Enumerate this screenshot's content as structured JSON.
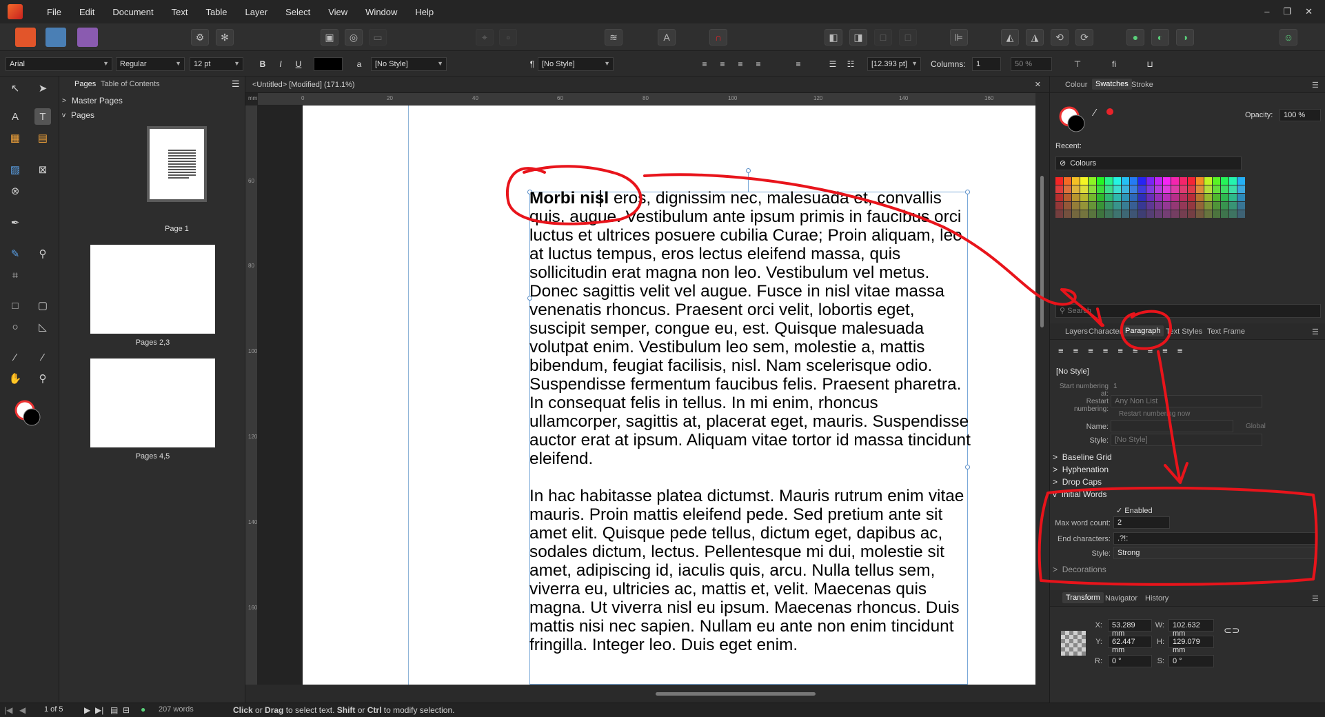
{
  "menu": {
    "items": [
      "File",
      "Edit",
      "Document",
      "Text",
      "Table",
      "Layer",
      "Select",
      "View",
      "Window",
      "Help"
    ],
    "window_controls": [
      "–",
      "❐",
      "✕"
    ]
  },
  "context_toolbar": {
    "font_family": "Arial",
    "font_style": "Regular",
    "font_size": "12 pt",
    "char_style": "[No Style]",
    "para_style": "[No Style]",
    "leading": "[12.393 pt]",
    "columns_label": "Columns:",
    "columns_value": "1",
    "gutter": "50 %",
    "bold": "B",
    "italic": "I",
    "underline": "U",
    "ligature": "fi"
  },
  "pages_panel": {
    "tabs": [
      "Pages",
      "Table of Contents"
    ],
    "master_pages": "Master Pages",
    "pages": "Pages",
    "thumbnails": [
      {
        "label": "Page 1"
      },
      {
        "label": "Pages 2,3"
      },
      {
        "label": "Pages 4,5"
      }
    ]
  },
  "document": {
    "title": "<Untitled> [Modified] (171.1%)",
    "ruler_unit": "mm",
    "ruler_h_ticks": [
      "0",
      "20",
      "40",
      "60",
      "80",
      "100",
      "120",
      "140",
      "160"
    ],
    "ruler_v_ticks": [
      "60",
      "80",
      "100",
      "120",
      "140",
      "160"
    ],
    "initial_words": "Morbi nisl",
    "paragraph1_rest": " eros, dignissim nec, malesuada et, convallis quis, augue. Vestibulum ante ipsum primis in faucibus orci luctus et ultrices posuere cubilia Curae; Proin aliquam, leo at luctus tempus, eros lectus eleifend massa, quis sollicitudin erat magna non leo. Vestibulum vel metus. Donec sagittis velit vel augue. Fusce in nisl vitae massa venenatis rhoncus. Praesent orci velit, lobortis eget, suscipit semper, congue eu, est. Quisque malesuada volutpat enim. Vestibulum leo sem, molestie a, mattis bibendum, feugiat facilisis, nisl. Nam scelerisque odio. Suspendisse fermentum faucibus felis. Praesent pharetra. In consequat felis in tellus. In mi enim, rhoncus ullamcorper, sagittis at, placerat eget, mauris. Suspendisse auctor erat at ipsum. Aliquam vitae tortor id massa tincidunt eleifend.",
    "paragraph2": "In hac habitasse platea dictumst. Mauris rutrum enim vitae mauris. Proin mattis eleifend pede. Sed pretium ante sit amet elit. Quisque pede tellus, dictum eget, dapibus ac, sodales dictum, lectus. Pellentesque mi dui, molestie sit amet, adipiscing id, iaculis quis, arcu. Nulla tellus sem, viverra eu, ultricies ac, mattis et, velit. Maecenas quis magna. Ut viverra nisl eu ipsum. Maecenas rhoncus. Duis mattis nisi nec sapien. Nullam eu ante non enim tincidunt fringilla. Integer leo. Duis eget enim."
  },
  "colour_panel": {
    "tabs": [
      "Colour",
      "Swatches",
      "Stroke"
    ],
    "opacity_label": "Opacity:",
    "opacity_value": "100 %",
    "recent_label": "Recent:",
    "palette_name": "Colours",
    "search_placeholder": "Search"
  },
  "paragraph_panel": {
    "tabs": [
      "Layers",
      "Character",
      "Paragraph",
      "Text Styles",
      "Text Frame"
    ],
    "style_value": "[No Style]",
    "start_numbering_label": "Start numbering at:",
    "start_numbering_value": "1",
    "restart_numbering_label": "Restart numbering:",
    "restart_numbering_value": "Any Non List",
    "restart_now": "Restart numbering now",
    "name_label": "Name:",
    "global_label": "Global",
    "style_label": "Style:",
    "style_field_value": "[No Style]",
    "sections": [
      "Baseline Grid",
      "Hyphenation",
      "Drop Caps"
    ],
    "initial_words": {
      "title": "Initial Words",
      "enabled_label": "Enabled",
      "max_word_count_label": "Max word count:",
      "max_word_count_value": "2",
      "end_characters_label": "End characters:",
      "end_characters_value": ".?!:",
      "style_label": "Style:",
      "style_value": "Strong"
    },
    "decorations": "Decorations"
  },
  "transform_panel": {
    "tabs": [
      "Transform",
      "Navigator",
      "History"
    ],
    "x_label": "X:",
    "x_value": "53.289 mm",
    "y_label": "Y:",
    "y_value": "62.447 mm",
    "w_label": "W:",
    "w_value": "102.632 mm",
    "h_label": "H:",
    "h_value": "129.079 mm",
    "r_label": "R:",
    "r_value": "0 °",
    "s_label": "S:",
    "s_value": "0 °"
  },
  "status_bar": {
    "page_indicator": "1 of 5",
    "word_count": "207 words",
    "hint_click": "Click",
    "hint_or1": " or ",
    "hint_drag": "Drag",
    "hint_mid": " to select text. ",
    "hint_shift": "Shift",
    "hint_or2": " or ",
    "hint_ctrl": "Ctrl",
    "hint_end": " to modify selection."
  },
  "colors": {
    "accent_red": "#e8232a",
    "annotation_red": "#e8141b",
    "frame_blue": "#7aa9d8"
  }
}
